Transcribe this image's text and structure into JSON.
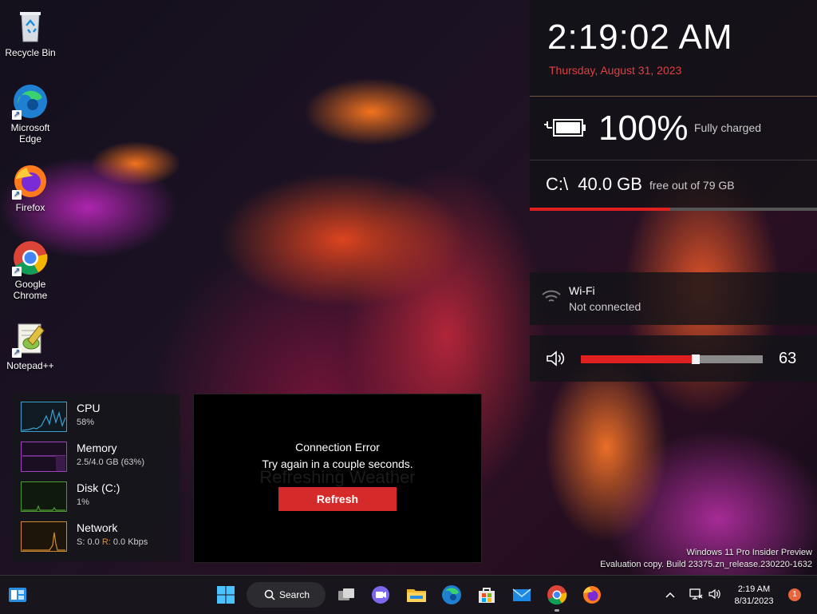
{
  "desktop": {
    "icons": [
      {
        "label": "Recycle Bin"
      },
      {
        "label": "Microsoft Edge"
      },
      {
        "label": "Firefox"
      },
      {
        "label": "Google Chrome"
      },
      {
        "label": "Notepad++"
      }
    ]
  },
  "clock": {
    "time": "2:19:02 AM",
    "date": "Thursday, August 31, 2023"
  },
  "battery": {
    "percent": "100%",
    "status": "Fully charged"
  },
  "disk": {
    "drive": "C:\\",
    "free_value": "40.0 GB",
    "free_text": "free out of 79 GB",
    "used_fraction": 0.49
  },
  "wifi": {
    "name": "Wi-Fi",
    "status": "Not connected"
  },
  "volume": {
    "level": 63,
    "level_text": "63"
  },
  "system_monitor": {
    "items": [
      {
        "title": "CPU",
        "value": "58%"
      },
      {
        "title": "Memory",
        "value": "2.5/4.0 GB (63%)"
      },
      {
        "title": "Disk (C:)",
        "value": "1%"
      },
      {
        "title": "Network",
        "value_s": "S: 0.0",
        "value_r_label": "R:",
        "value_r": "0.0 Kbps"
      }
    ]
  },
  "weather": {
    "title": "Connection Error",
    "subtitle": "Try again in a couple seconds.",
    "ghost": "Refreshing Weather",
    "button": "Refresh"
  },
  "watermark": {
    "line1": "Windows 11 Pro Insider Preview",
    "line2": "Evaluation copy. Build 23375.zn_release.230220-1632"
  },
  "taskbar": {
    "search_label": "Search",
    "tray_time": "2:19 AM",
    "tray_date": "8/31/2023",
    "notification_count": "1"
  },
  "colors": {
    "accent_red": "#e02020",
    "date_red": "#e04040",
    "cpu_graph": "#3aa0d0",
    "memory_graph": "#a040c0",
    "disk_graph": "#4a9a30",
    "network_graph": "#d08a30"
  }
}
